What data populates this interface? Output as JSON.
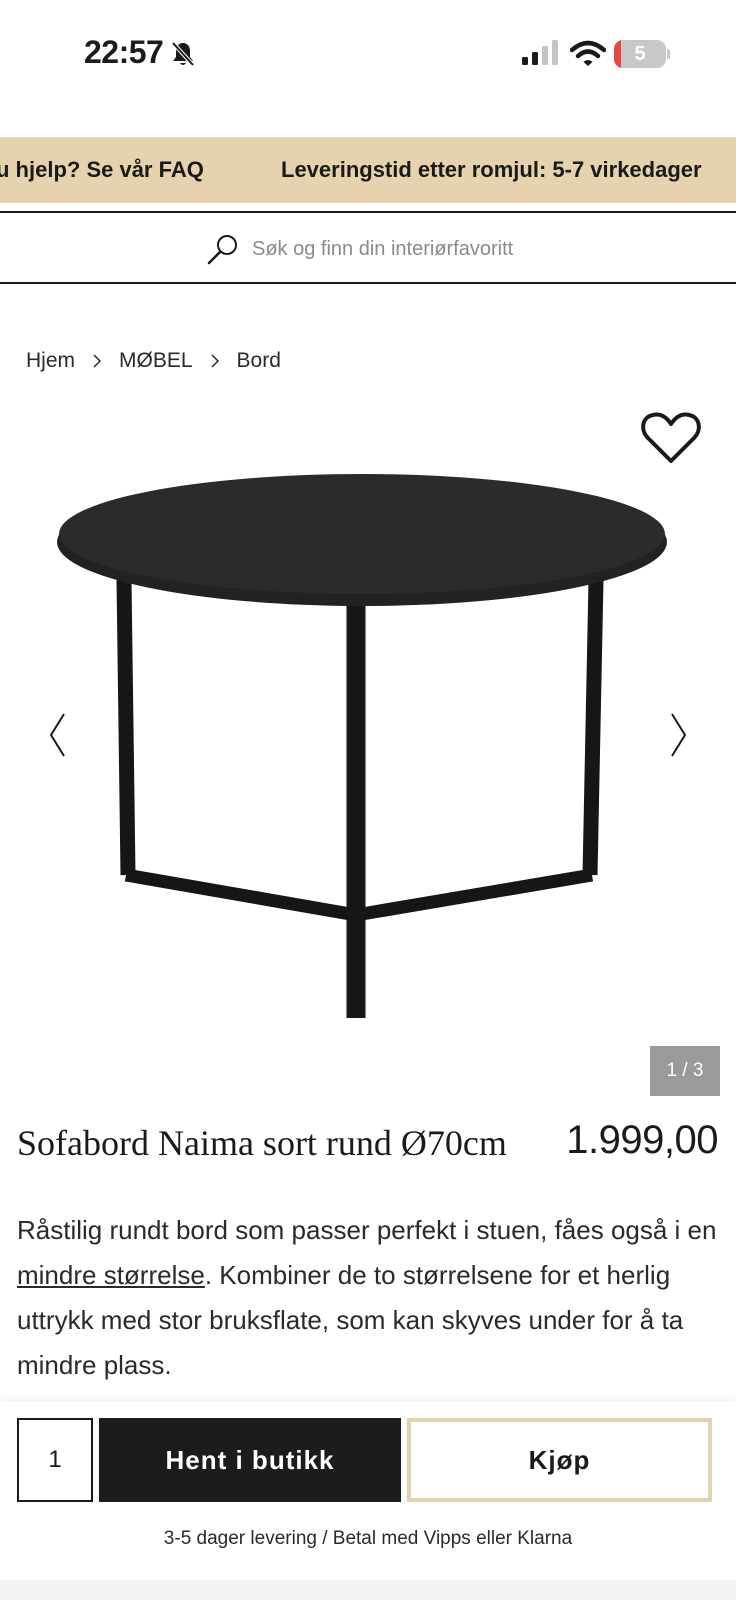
{
  "status_bar": {
    "time": "22:57",
    "battery_level": "5",
    "icons": [
      "bell-slash-icon",
      "signal-icon",
      "wifi-icon",
      "battery-icon"
    ]
  },
  "promo_banner": {
    "items": [
      "u hjelp? Se vår FAQ",
      "Leveringstid etter romjul: 5-7 virkedager"
    ]
  },
  "search": {
    "placeholder": "Søk og finn din interiørfavoritt"
  },
  "breadcrumb": {
    "items": [
      "Hjem",
      "MØBEL",
      "Bord"
    ]
  },
  "gallery": {
    "counter": "1 / 3"
  },
  "product": {
    "title": "Sofabord Naima sort rund Ø70cm",
    "price": "1.999,00",
    "description_before_link": "Råstilig rundt bord som passer perfekt i stuen, fåes også i en ",
    "description_link": "mindre størrelse",
    "description_after_link": ". Kombiner de to størrelsene for et herlig uttrykk med stor bruksflate, som kan skyves under for å ta mindre plass."
  },
  "purchase_bar": {
    "quantity": "1",
    "pickup_label": "Hent i butikk",
    "buy_label": "Kjøp",
    "delivery_note": "3-5 dager levering / Betal med Vipps eller Klarna"
  },
  "colors": {
    "banner_bg": "#e6d3ad",
    "buy_border": "#e3d2ae",
    "dark": "#1c1c1c",
    "counter_bg": "#9a9a9a"
  }
}
